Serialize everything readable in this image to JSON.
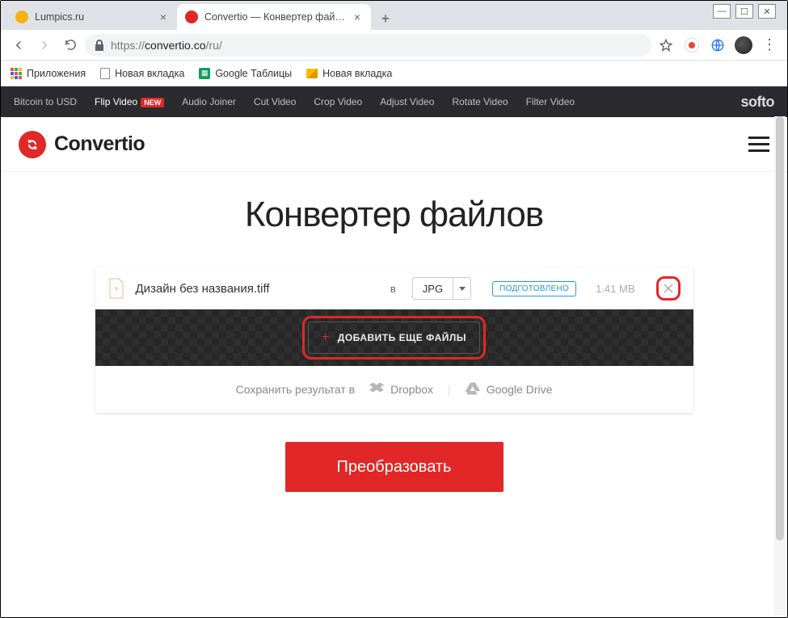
{
  "browser": {
    "tabs": [
      {
        "title": "Lumpics.ru",
        "favicon_color": "#f5b213"
      },
      {
        "title": "Convertio — Конвертер файлов",
        "favicon_color": "#e12727"
      }
    ],
    "url_scheme": "https://",
    "url_host": "convertio.co",
    "url_path": "/ru/"
  },
  "bookmarks": {
    "apps": "Приложения",
    "items": [
      "Новая вкладка",
      "Google Таблицы",
      "Новая вкладка"
    ]
  },
  "softo": {
    "links": [
      "Bitcoin to USD",
      "Flip Video",
      "Audio Joiner",
      "Cut Video",
      "Crop Video",
      "Adjust Video",
      "Rotate Video",
      "Filter Video"
    ],
    "new_badge": "NEW",
    "logo": "softo"
  },
  "brand": "Convertio",
  "page_title": "Конвертер файлов",
  "file": {
    "name": "Дизайн без названия.tiff",
    "to_label": "в",
    "target_format": "JPG",
    "status": "ПОДГОТОВЛЕНО",
    "size": "1.41 MB"
  },
  "add_more_label": "ДОБАВИТЬ ЕЩЕ ФАЙЛЫ",
  "save": {
    "prefix": "Сохранить результат в",
    "dropbox": "Dropbox",
    "gdrive": "Google Drive"
  },
  "convert_label": "Преобразовать"
}
